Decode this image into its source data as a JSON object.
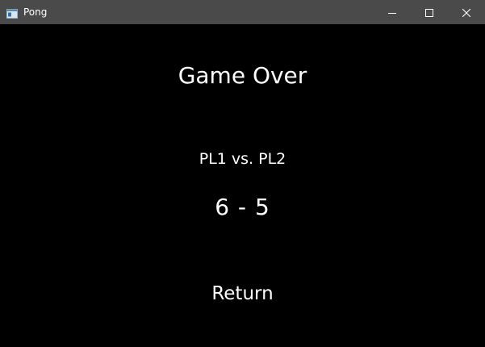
{
  "window": {
    "title": "Pong",
    "icon": "app-window-icon",
    "controls": {
      "minimize": "minimize-icon",
      "maximize": "maximize-icon",
      "close": "close-icon"
    }
  },
  "game_over": {
    "heading": "Game Over",
    "players_label": "PL1 vs. PL2",
    "score": "6 - 5",
    "return_label": "Return"
  },
  "colors": {
    "titlebar": "#4a4a4a",
    "background": "#000000",
    "text": "#ffffff"
  }
}
